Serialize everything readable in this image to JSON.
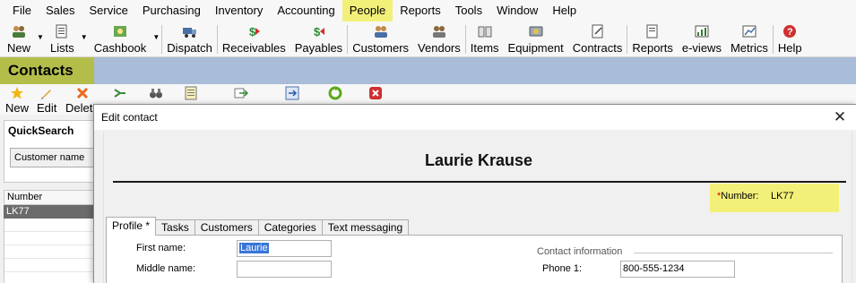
{
  "menubar": {
    "items": [
      "File",
      "Sales",
      "Service",
      "Purchasing",
      "Inventory",
      "Accounting",
      "People",
      "Reports",
      "Tools",
      "Window",
      "Help"
    ],
    "active": "People"
  },
  "toolbar": {
    "new": "New",
    "lists": "Lists",
    "cashbook": "Cashbook",
    "dispatch": "Dispatch",
    "receivables": "Receivables",
    "payables": "Payables",
    "customers": "Customers",
    "vendors": "Vendors",
    "items": "Items",
    "equipment": "Equipment",
    "contracts": "Contracts",
    "reports": "Reports",
    "eviews": "e-views",
    "metrics": "Metrics",
    "help": "Help"
  },
  "contacts": {
    "title": "Contacts",
    "toolbar": {
      "new": "New",
      "edit": "Edit",
      "delete": "Delete"
    },
    "quicksearch": {
      "title": "QuickSearch",
      "field": "Customer name"
    },
    "grid": {
      "header": "Number",
      "rows": [
        "LK77"
      ]
    }
  },
  "dialog": {
    "title": "Edit contact",
    "close": "✕",
    "contact_name": "Laurie Krause",
    "number_label": "Number:",
    "number_required": "*",
    "number_value": "LK77",
    "tabs": [
      "Profile *",
      "Tasks",
      "Customers",
      "Categories",
      "Text messaging"
    ],
    "profile": {
      "first_name_label": "First name:",
      "first_name": "Laurie",
      "middle_name_label": "Middle name:",
      "middle_name": "",
      "contact_info_label": "Contact information",
      "phone1_label": "Phone 1:",
      "phone1": "800-555-1234"
    }
  },
  "colors": {
    "highlight": "#f3f07a",
    "contacts_title_bg": "#b3be4a",
    "contacts_bar_bg": "#a9bcd8",
    "selection": "#3875d7",
    "grid_selected_row": "#6b6b6b"
  }
}
